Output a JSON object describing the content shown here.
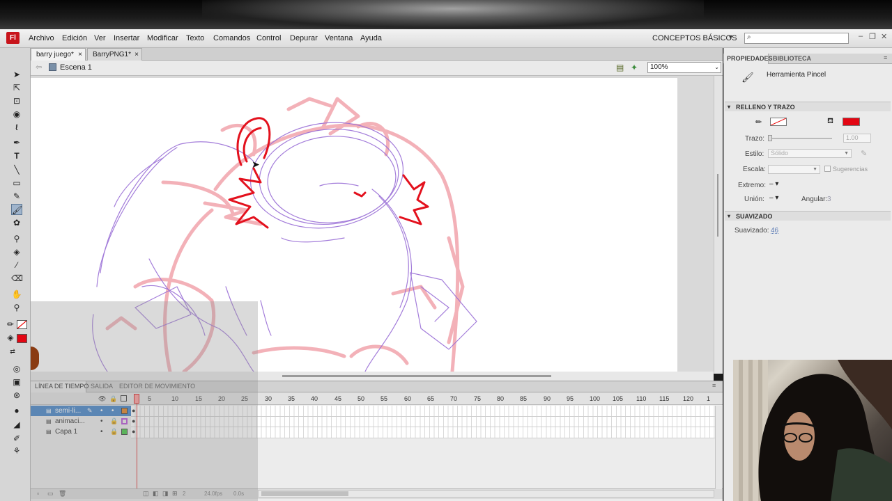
{
  "menubar": {
    "logo": "Fl",
    "items": [
      "Archivo",
      "Edición",
      "Ver",
      "Insertar",
      "Modificar",
      "Texto",
      "Comandos",
      "Control",
      "Depurar",
      "Ventana",
      "Ayuda"
    ],
    "workspace": "CONCEPTOS BÁSICOS",
    "workspace_arrow": "▼",
    "search_placeholder": "",
    "window_buttons": [
      "‒",
      "❐",
      "✕"
    ]
  },
  "doc_tabs": [
    {
      "label": "barry juego*",
      "close": "×",
      "active": true
    },
    {
      "label": "BarryPNG1*",
      "close": "×",
      "active": false
    }
  ],
  "editbar": {
    "scene": "Escena 1",
    "zoom": "100%"
  },
  "timeline": {
    "tabs": [
      "LÍNEA DE TIEMPO",
      "SALIDA",
      "EDITOR DE MOVIMIENTO"
    ],
    "frame_numbers": [
      "1",
      "5",
      "10",
      "15",
      "20",
      "25",
      "30",
      "35",
      "40",
      "45",
      "50",
      "55",
      "60",
      "65",
      "70",
      "75",
      "80",
      "85",
      "90",
      "95",
      "100",
      "105",
      "110",
      "115",
      "120",
      "1"
    ],
    "current_frame": 1,
    "layers": [
      {
        "name": "semi-li...",
        "color": "#e07b16",
        "selected": true
      },
      {
        "name": "animaci...",
        "color": "#b44bd6",
        "selected": false
      },
      {
        "name": "Capa 1",
        "color": "#3cc43c",
        "selected": false
      }
    ],
    "status": {
      "frame": "2",
      "fps": "24.0fps",
      "time": "0.0s"
    }
  },
  "properties": {
    "tabs": [
      "PROPIEDADES",
      "BIBLIOTECA"
    ],
    "tool_name": "Herramienta Pincel",
    "sections": {
      "fill_stroke": "RELLENO Y TRAZO",
      "smoothing": "SUAVIZADO"
    },
    "fill_color": "#e30613",
    "labels": {
      "trazo": "Trazo:",
      "trazo_value": "1.00",
      "estilo": "Estilo:",
      "estilo_value": "Sólido",
      "escala": "Escala:",
      "sugerencias": "Sugerencias",
      "extremo": "Extremo:",
      "union": "Unión:",
      "angular": "Angular:",
      "angular_value": "3",
      "suavizado": "Suavizado:",
      "suavizado_value": "46"
    }
  },
  "tools_colors": {
    "stroke": "none",
    "fill": "#e30613"
  }
}
